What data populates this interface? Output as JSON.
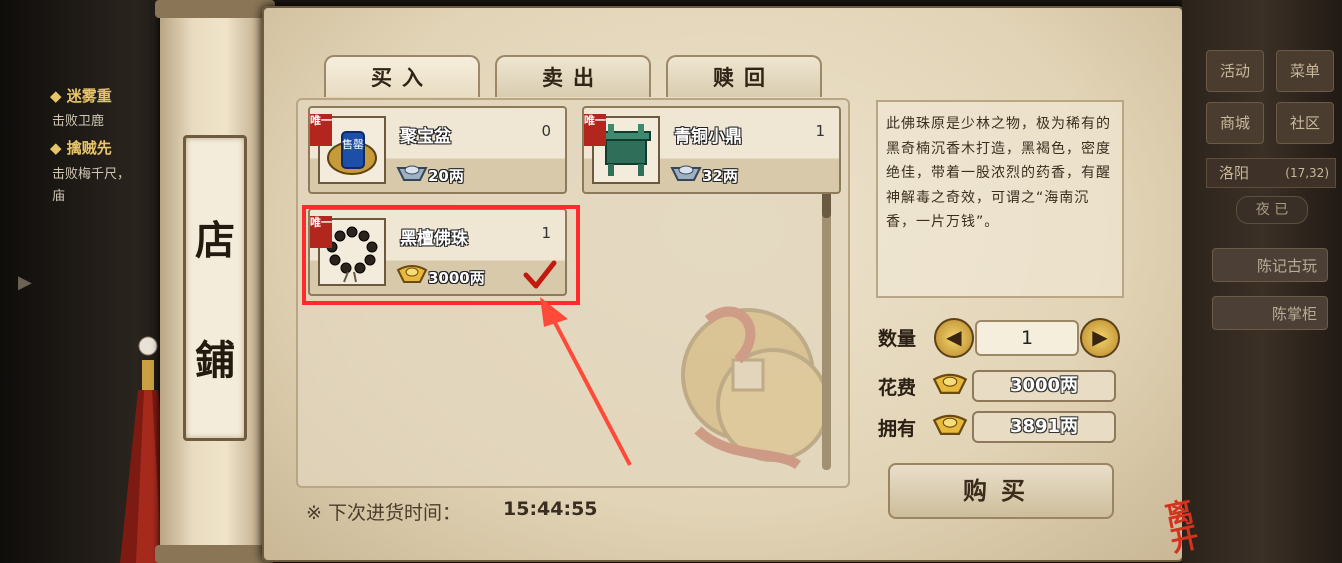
{
  "quests": [
    {
      "title": "◆ 迷雾重",
      "desc": "击败卫鹿"
    },
    {
      "title": "◆ 擒贼先",
      "desc": "击败梅千尺，"
    },
    {
      "title": "",
      "desc": "庙"
    }
  ],
  "shop_title": [
    "店",
    "鋪"
  ],
  "tabs": [
    {
      "label": "买入",
      "active": true
    },
    {
      "label": "卖出",
      "active": false
    },
    {
      "label": "赎回",
      "active": false
    }
  ],
  "items": [
    {
      "name": "聚宝盆",
      "count": "0",
      "price": "20两",
      "badge": "唯一",
      "icon_label": "售罄",
      "currency": "silver-icon",
      "selected": false
    },
    {
      "name": "青铜小鼎",
      "count": "1",
      "price": "32两",
      "badge": "唯一",
      "currency": "silver-icon",
      "selected": false
    },
    {
      "name": "黑檀佛珠",
      "count": "1",
      "price": "3000两",
      "badge": "唯一",
      "currency": "gold-ingot-icon",
      "selected": true
    }
  ],
  "restock": {
    "label": "※ 下次进货时间：",
    "time": "15:44:55"
  },
  "description": "此佛珠原是少林之物，极为稀有的黑奇楠沉香木打造，黑褐色，密度绝佳，带着一股浓烈的药香，有醒神解毒之奇效，可谓之“海南沉香，一片万钱”。",
  "purchase": {
    "qty_label": "数量",
    "qty_value": "1",
    "cost_label": "花费",
    "cost_value": "3000两",
    "own_label": "拥有",
    "own_value": "3891两",
    "buy_label": "购买"
  },
  "hud": {
    "buttons": [
      "活动",
      "菜单",
      "商城",
      "社区"
    ],
    "location": "洛阳",
    "coords": "(17,32)",
    "time_label": "夜 已",
    "npcs": [
      "陈记古玩",
      "陈掌柜"
    ]
  },
  "leave_label": "离开",
  "colors": {
    "highlight": "#ff2a2a",
    "accent_gold": "#e8c46a"
  }
}
